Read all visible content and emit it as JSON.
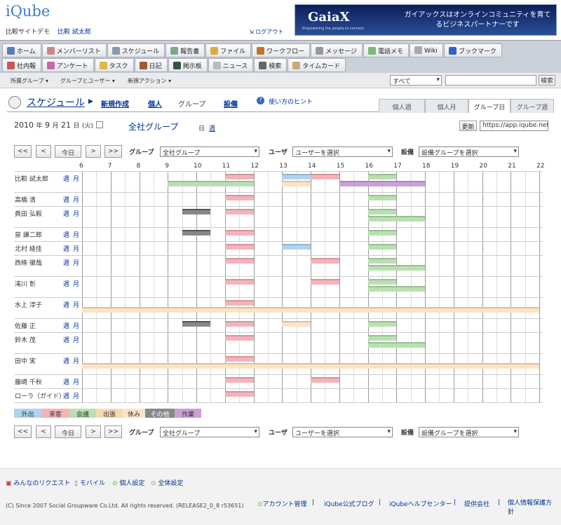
{
  "header": {
    "logo": "iQube",
    "site": "比較サイトデモ",
    "user": "比較 試太郎",
    "logout": "ログアウト",
    "banner": {
      "brand": "GaiaX",
      "tagline": "Empowering the people to connect",
      "message": "ガイアックスはオンラインコミュニティを育てるビジネスパートナーです"
    }
  },
  "nav": {
    "row1": [
      {
        "label": "ホーム",
        "icon": "home-icon",
        "color": "#5b7bb5"
      },
      {
        "label": "メンバーリスト",
        "icon": "members-icon",
        "color": "#c88"
      },
      {
        "label": "スケジュール",
        "icon": "schedule-icon",
        "color": "#89a"
      },
      {
        "label": "報告書",
        "icon": "report-icon",
        "color": "#7a8"
      },
      {
        "label": "ファイル",
        "icon": "file-icon",
        "color": "#da4"
      },
      {
        "label": "ワークフロー",
        "icon": "workflow-icon",
        "color": "#b73"
      },
      {
        "label": "メッセージ",
        "icon": "message-icon",
        "color": "#999"
      },
      {
        "label": "電話メモ",
        "icon": "phone-memo-icon",
        "color": "#7b7"
      },
      {
        "label": "Wiki",
        "icon": "wiki-icon",
        "color": "#aaa"
      },
      {
        "label": "ブックマーク",
        "icon": "bookmark-icon",
        "color": "#36b"
      }
    ],
    "row2": [
      {
        "label": "社内報",
        "icon": "newsletter-icon",
        "color": "#c55"
      },
      {
        "label": "アンケート",
        "icon": "survey-icon",
        "color": "#c6a"
      },
      {
        "label": "タスク",
        "icon": "task-icon",
        "color": "#db4"
      },
      {
        "label": "日記",
        "icon": "diary-icon",
        "color": "#a53"
      },
      {
        "label": "掲示板",
        "icon": "board-icon",
        "color": "#354"
      },
      {
        "label": "ニュース",
        "icon": "news-icon",
        "color": "#bbb"
      },
      {
        "label": "検索",
        "icon": "search-icon",
        "color": "#666"
      },
      {
        "label": "タイムカード",
        "icon": "timecard-icon",
        "color": "#ca7"
      }
    ]
  },
  "subbar": {
    "menus": [
      "所属グループ ▾",
      "グループとユーザー ▾",
      "新規アクション ▾"
    ],
    "scope": "すべて",
    "search_button": "検索"
  },
  "page": {
    "title": "スケジュール",
    "new": "新規作成",
    "personal": "個人",
    "group": "グループ",
    "facility": "設備",
    "help": "使い方のヒント"
  },
  "tabs": [
    "個人週",
    "個人月",
    "グループ日",
    "グループ週"
  ],
  "date": {
    "year": "2010",
    "y": "年",
    "month": "9",
    "m": "月",
    "day": "21",
    "d": "日",
    "dow": "(火)",
    "group": "全社グループ",
    "day_link": "日",
    "week_link": "週",
    "refresh": "更新",
    "url": "https://app.iqube.net"
  },
  "controls": {
    "first": "<<",
    "prev": "<",
    "today": "今日",
    "next": ">",
    "last": ">>",
    "group_label": "グループ",
    "group_value": "全社グループ",
    "user_label": "ユーザ",
    "user_value": "ユーザーを選択",
    "facility_label": "設備",
    "facility_value": "設備グループを選択"
  },
  "hours": [
    "6",
    "7",
    "8",
    "9",
    "10",
    "11",
    "12",
    "13",
    "14",
    "15",
    "16",
    "17",
    "18",
    "19",
    "20",
    "21",
    "22"
  ],
  "row_links": {
    "week": "週",
    "month": "月"
  },
  "colors": {
    "外出": "#aed4f0",
    "来客": "#f5b3b8",
    "会議": "#b8e0b0",
    "出張": "#f7d9b0",
    "休み": "#fde3c4",
    "その他": "#888888",
    "作業": "#c9a0d8"
  },
  "members": [
    {
      "name": "比較 試太郎",
      "events": [
        {
          "s": 11,
          "e": 12,
          "c": "来客"
        },
        {
          "s": 13,
          "e": 14,
          "c": "外出"
        },
        {
          "s": 14,
          "e": 15,
          "c": "来客"
        },
        {
          "s": 16,
          "e": 17,
          "c": "会議"
        },
        {
          "s": 9,
          "e": 12,
          "c": "会議"
        },
        {
          "s": 13,
          "e": 14,
          "c": "休み"
        },
        {
          "s": 15,
          "e": 18,
          "c": "作業"
        }
      ]
    },
    {
      "name": "高橋 清",
      "events": [
        {
          "s": 11,
          "e": 12,
          "c": "来客"
        },
        {
          "s": 16,
          "e": 17,
          "c": "会議"
        }
      ]
    },
    {
      "name": "眞田 弘毅",
      "events": [
        {
          "s": 9.5,
          "e": 10.5,
          "c": "その他"
        },
        {
          "s": 11,
          "e": 12,
          "c": "来客"
        },
        {
          "s": 16,
          "e": 17,
          "c": "会議"
        },
        {
          "s": 16,
          "e": 18,
          "c": "会議"
        }
      ]
    },
    {
      "name": "泉 謙二郎",
      "events": [
        {
          "s": 9.5,
          "e": 10.5,
          "c": "その他"
        },
        {
          "s": 11,
          "e": 12,
          "c": "来客"
        },
        {
          "s": 16,
          "e": 17,
          "c": "会議"
        }
      ]
    },
    {
      "name": "北村 綾佳",
      "events": [
        {
          "s": 11,
          "e": 12,
          "c": "来客"
        },
        {
          "s": 13,
          "e": 14,
          "c": "外出"
        },
        {
          "s": 16,
          "e": 17,
          "c": "会議"
        }
      ]
    },
    {
      "name": "西條 徹哉",
      "events": [
        {
          "s": 11,
          "e": 12,
          "c": "来客"
        },
        {
          "s": 14,
          "e": 15,
          "c": "来客"
        },
        {
          "s": 16,
          "e": 17,
          "c": "会議"
        },
        {
          "s": 16,
          "e": 18,
          "c": "会議"
        }
      ]
    },
    {
      "name": "滝川 彰",
      "events": [
        {
          "s": 11,
          "e": 12,
          "c": "来客"
        },
        {
          "s": 14,
          "e": 15,
          "c": "来客"
        },
        {
          "s": 16,
          "e": 17,
          "c": "会議"
        },
        {
          "s": 16,
          "e": 18,
          "c": "会議"
        }
      ]
    },
    {
      "name": "水上 淳子",
      "events": [
        {
          "s": 11,
          "e": 12,
          "c": "来客"
        },
        {
          "s": 6,
          "e": 22,
          "c": "休み"
        }
      ]
    },
    {
      "name": "佐藤 正",
      "events": [
        {
          "s": 9.5,
          "e": 10.5,
          "c": "その他"
        },
        {
          "s": 11,
          "e": 12,
          "c": "来客"
        },
        {
          "s": 13,
          "e": 14,
          "c": "休み"
        },
        {
          "s": 16,
          "e": 17,
          "c": "会議"
        }
      ]
    },
    {
      "name": "鈴木 茂",
      "events": [
        {
          "s": 11,
          "e": 12,
          "c": "来客"
        },
        {
          "s": 16,
          "e": 17,
          "c": "会議"
        },
        {
          "s": 16,
          "e": 18,
          "c": "会議"
        }
      ]
    },
    {
      "name": "田中 実",
      "events": [
        {
          "s": 11,
          "e": 12,
          "c": "来客"
        },
        {
          "s": 6,
          "e": 22,
          "c": "休み"
        }
      ]
    },
    {
      "name": "藤崎 千秋",
      "events": [
        {
          "s": 11,
          "e": 12,
          "c": "来客"
        },
        {
          "s": 14,
          "e": 15,
          "c": "来客"
        }
      ]
    },
    {
      "name": "ローラ（ガイド）",
      "events": [
        {
          "s": 11,
          "e": 12,
          "c": "来客"
        }
      ]
    }
  ],
  "legend": [
    "外出",
    "来客",
    "会議",
    "出張",
    "休み",
    "その他",
    "作業"
  ],
  "footer": {
    "links": [
      "みんなのリクエスト",
      "モバイル",
      "個人設定",
      "全体設定"
    ],
    "copyright": "(C) Since 2007 Social Groupware Co.Ltd. All rights reserved. (RELEASE2_0_8 r53651)",
    "bottom_links": [
      "アカウント管理",
      "iQube公式ブログ",
      "iQubeヘルプセンター",
      "提供会社",
      "個人情報保護方針"
    ]
  }
}
